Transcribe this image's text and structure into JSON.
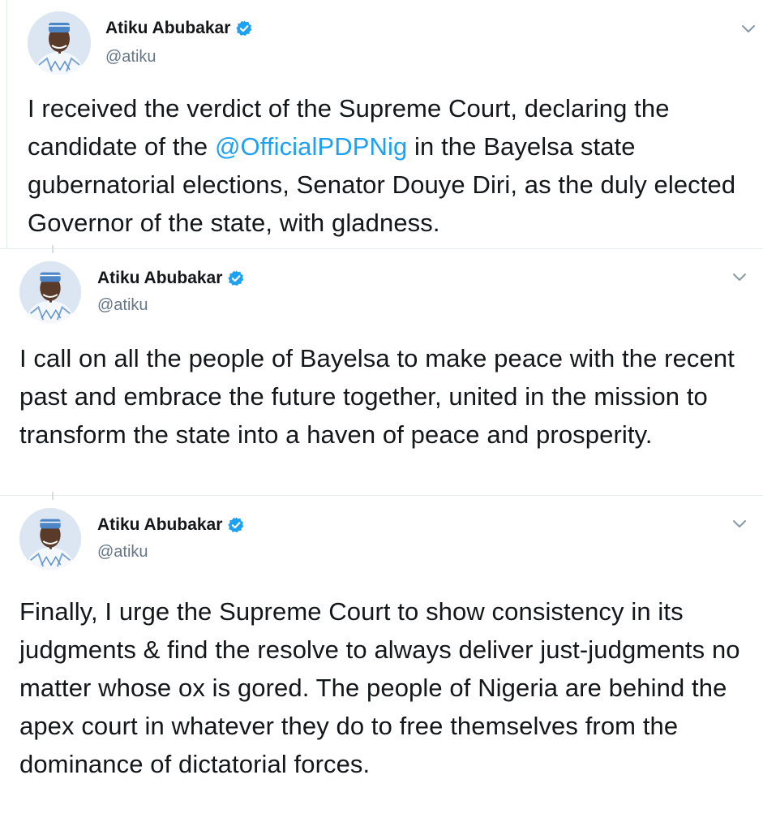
{
  "colors": {
    "text": "#14171a",
    "secondary": "#657786",
    "link": "#1da1f2",
    "verified": "#1da1f2",
    "divider": "#e6ecf0"
  },
  "icons": {
    "verified": "verified-badge-icon",
    "menu": "chevron-down-icon"
  },
  "tweets": [
    {
      "author": {
        "name": "Atiku Abubakar",
        "handle": "@atiku",
        "verified": true
      },
      "text_before": "I received the verdict of the Supreme Court, declaring the candidate of the ",
      "mention": "@OfficialPDPNig",
      "text_after": " in the Bayelsa state gubernatorial elections, Senator Douye Diri, as the duly elected Governor of the state, with gladness."
    },
    {
      "author": {
        "name": "Atiku Abubakar",
        "handle": "@atiku",
        "verified": true
      },
      "text": "I call on all the people of Bayelsa to make peace with the recent past and embrace the future together, united in the mission to transform the state into a haven of peace and prosperity."
    },
    {
      "author": {
        "name": "Atiku Abubakar",
        "handle": "@atiku",
        "verified": true
      },
      "text": "Finally, I urge the Supreme Court to show consistency in its judgments & find the resolve to always deliver just-judgments no matter whose ox is gored. The people of Nigeria are behind the apex court in whatever they do to free themselves from the dominance of dictatorial forces."
    }
  ]
}
